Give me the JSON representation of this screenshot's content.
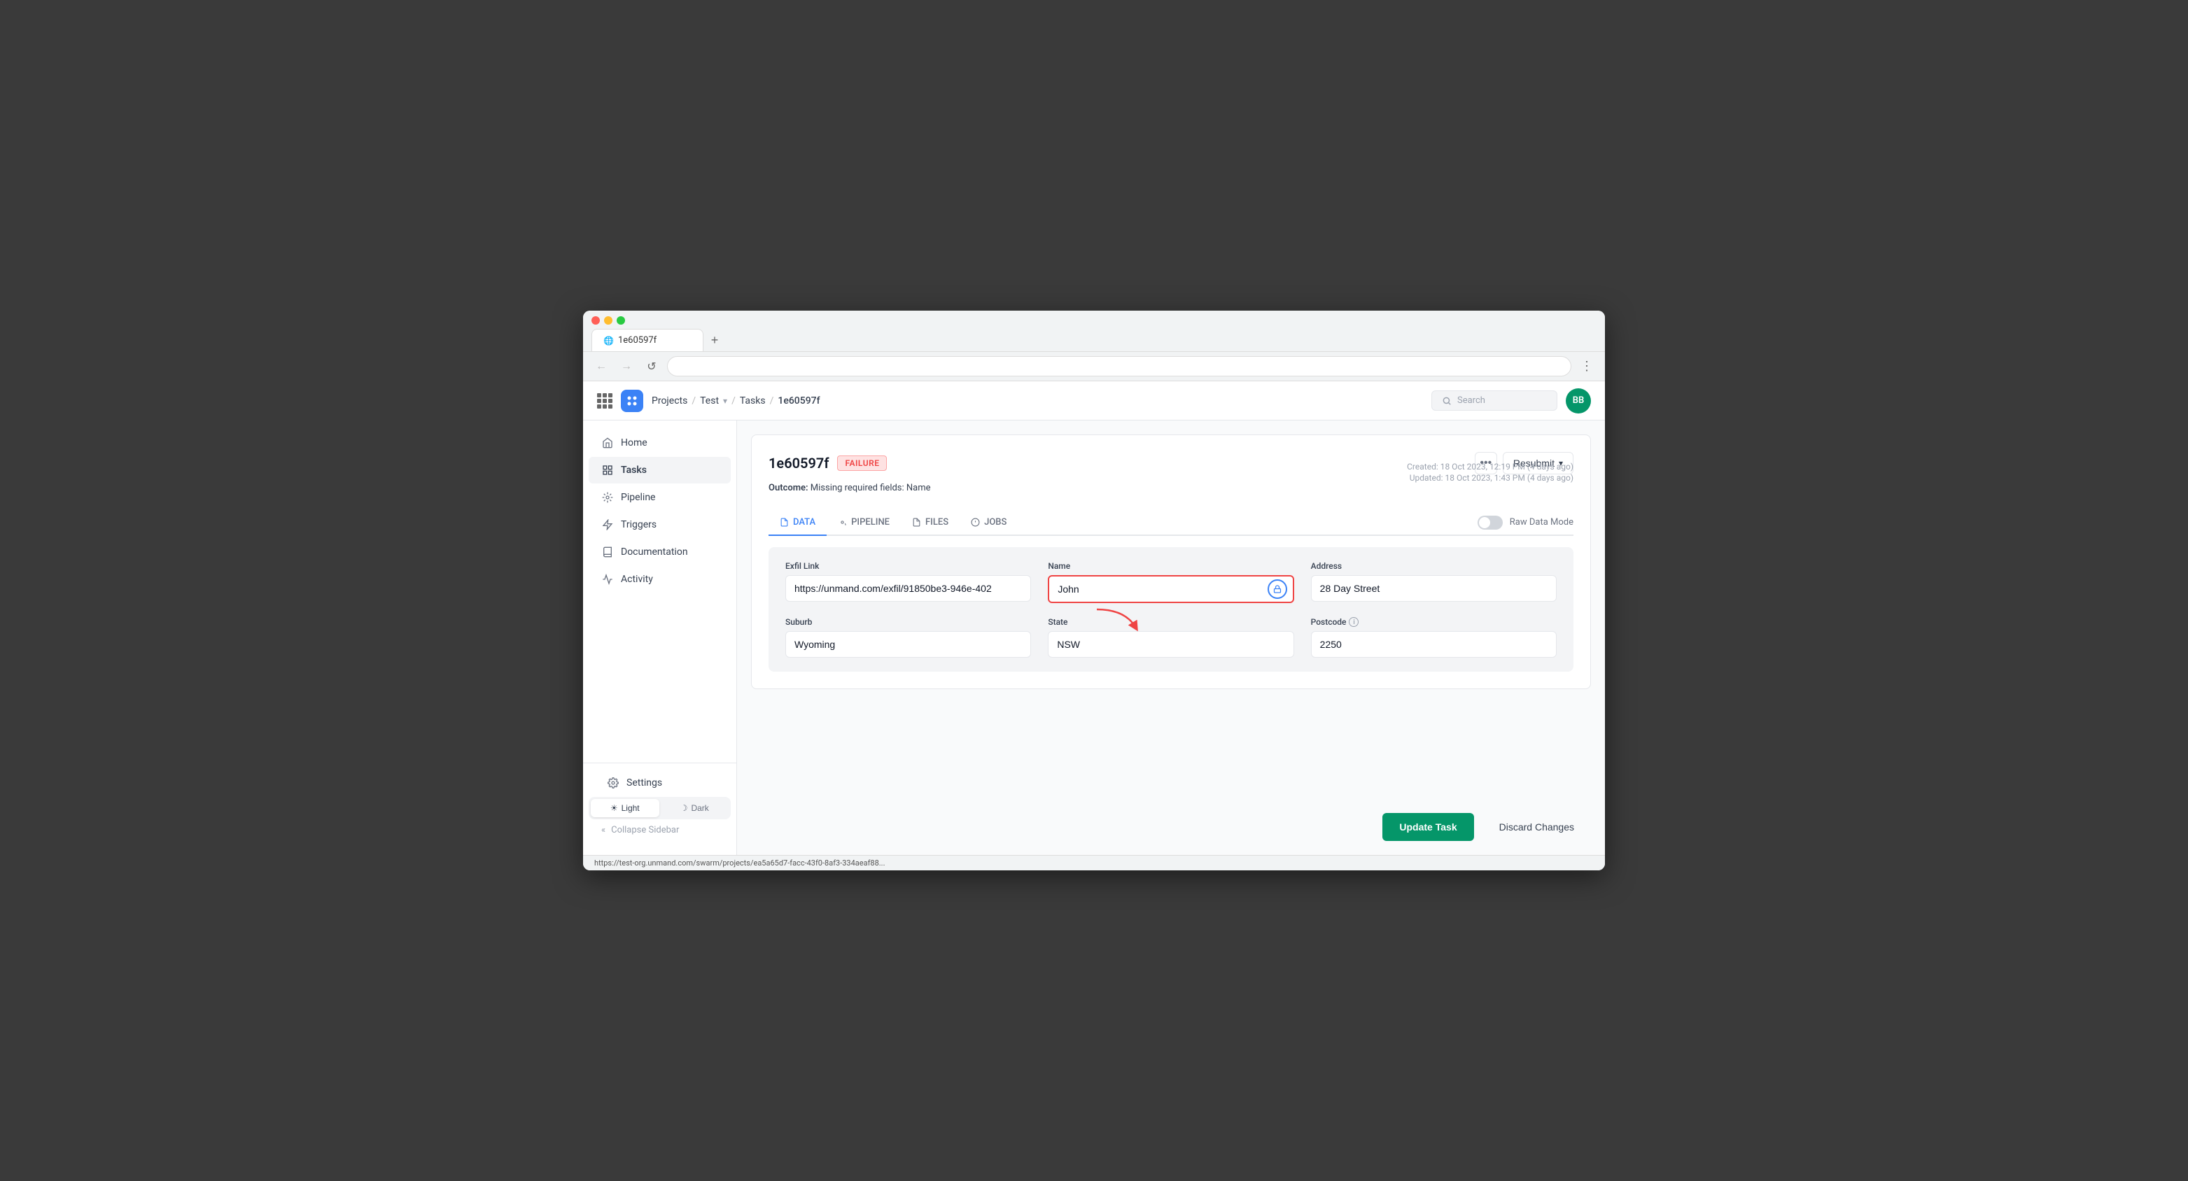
{
  "browser": {
    "tab_title": "1e60597f",
    "address": "",
    "new_tab_label": "+",
    "more_label": "⋮",
    "back_label": "←",
    "forward_label": "→",
    "refresh_label": "↺"
  },
  "header": {
    "grid_label": "apps",
    "logo_alt": "app-logo",
    "breadcrumb": [
      "Projects",
      "Test",
      "Tasks",
      "1e60597f"
    ],
    "search_placeholder": "Search",
    "user_initials": "BB"
  },
  "sidebar": {
    "items": [
      {
        "id": "home",
        "label": "Home",
        "icon": "home"
      },
      {
        "id": "tasks",
        "label": "Tasks",
        "icon": "tasks"
      },
      {
        "id": "pipeline",
        "label": "Pipeline",
        "icon": "pipeline"
      },
      {
        "id": "triggers",
        "label": "Triggers",
        "icon": "triggers"
      },
      {
        "id": "documentation",
        "label": "Documentation",
        "icon": "documentation"
      },
      {
        "id": "activity",
        "label": "Activity",
        "icon": "activity"
      }
    ],
    "settings_label": "Settings",
    "theme": {
      "light_label": "Light",
      "dark_label": "Dark",
      "active": "light"
    },
    "collapse_label": "Collapse Sidebar"
  },
  "task": {
    "id": "1e60597f",
    "status": "FAILURE",
    "outcome_label": "Outcome:",
    "outcome_value": "Missing required fields: Name",
    "created": "Created: 18 Oct 2023, 12:19 PM (4 days ago)",
    "updated": "Updated: 18 Oct 2023, 1:43 PM (4 days ago)",
    "dots_label": "•••",
    "resubmit_label": "Resubmit",
    "tabs": [
      {
        "id": "data",
        "label": "DATA",
        "icon": "data"
      },
      {
        "id": "pipeline",
        "label": "PIPELINE",
        "icon": "pipeline"
      },
      {
        "id": "files",
        "label": "FILES",
        "icon": "files"
      },
      {
        "id": "jobs",
        "label": "JOBS",
        "icon": "jobs"
      }
    ],
    "active_tab": "data",
    "raw_data_mode_label": "Raw Data Mode",
    "form": {
      "exfil_link_label": "Exfil Link",
      "exfil_link_value": "https://unmand.com/exfil/91850be3-946e-402",
      "name_label": "Name",
      "name_value": "John",
      "address_label": "Address",
      "address_value": "28 Day Street",
      "suburb_label": "Suburb",
      "suburb_value": "Wyoming",
      "state_label": "State",
      "state_value": "NSW",
      "postcode_label": "Postcode",
      "postcode_value": "2250"
    },
    "update_btn_label": "Update Task",
    "discard_btn_label": "Discard Changes"
  },
  "status_bar": {
    "url": "https://test-org.unmand.com/swarm/projects/ea5a65d7-facc-43f0-8af3-334aeaf88..."
  },
  "colors": {
    "accent": "#3b82f6",
    "success": "#059669",
    "danger": "#ef4444",
    "danger_bg": "#fee2e2",
    "logo_bg": "#3b82f6"
  }
}
